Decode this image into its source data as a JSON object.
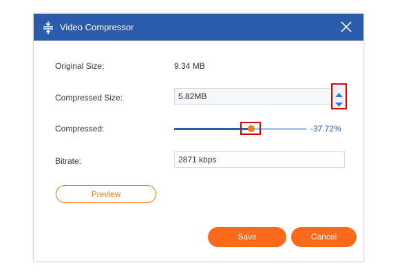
{
  "dialog": {
    "title": "Video Compressor",
    "title_icon": "compress-icon",
    "close_icon": "close-icon",
    "header_color": "#2a5cab",
    "accent_color": "#fa6a1b"
  },
  "fields": {
    "original_size_label": "Original Size:",
    "original_size_value": "9.34 MB",
    "compressed_size_label": "Compressed Size:",
    "compressed_size_value": "5.82MB",
    "compressed_label": "Compressed:",
    "compressed_percent": "-37.72%",
    "compression_slider_level": 0.58,
    "bitrate_label": "Bitrate:",
    "bitrate_value": "2871 kbps"
  },
  "buttons": {
    "preview": "Preview",
    "save": "Save",
    "cancel": "Cancel"
  }
}
